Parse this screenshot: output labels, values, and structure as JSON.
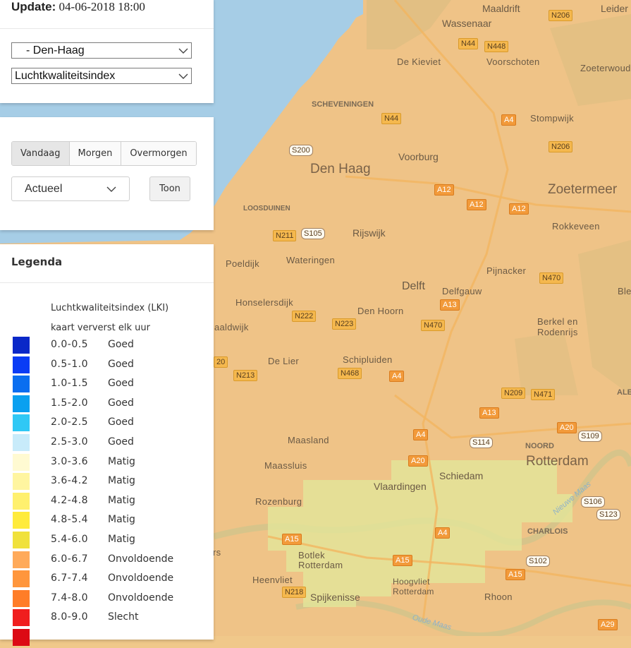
{
  "header": {
    "update_label": "Update:",
    "update_value": "04-06-2018 18:00"
  },
  "selects": {
    "location": "- Den-Haag",
    "index": "Luchtkwaliteitsindex"
  },
  "day_tabs": [
    "Vandaag",
    "Morgen",
    "Overmorgen"
  ],
  "active_tab": "Vandaag",
  "time_dropdown": "Actueel",
  "show_button": "Toon",
  "legend": {
    "title": "Legenda",
    "subtitle_1": "Luchtkwaliteitsindex (LKI)",
    "subtitle_2": "kaart ververst elk uur",
    "rows": [
      {
        "range": "0.0-0.5",
        "label": "Goed",
        "color": "#0a28c8"
      },
      {
        "range": "0.5-1.0",
        "label": "Goed",
        "color": "#0a3cf5"
      },
      {
        "range": "1.0-1.5",
        "label": "Goed",
        "color": "#0a6ef0"
      },
      {
        "range": "1.5-2.0",
        "label": "Goed",
        "color": "#0aa0f0"
      },
      {
        "range": "2.0-2.5",
        "label": "Goed",
        "color": "#30c8f5"
      },
      {
        "range": "2.5-3.0",
        "label": "Goed",
        "color": "#c8ebfa"
      },
      {
        "range": "3.0-3.6",
        "label": "Matig",
        "color": "#fffad2"
      },
      {
        "range": "3.6-4.2",
        "label": "Matig",
        "color": "#fff5a0"
      },
      {
        "range": "4.2-4.8",
        "label": "Matig",
        "color": "#fff06e"
      },
      {
        "range": "4.8-5.4",
        "label": "Matig",
        "color": "#ffeb3c"
      },
      {
        "range": "5.4-6.0",
        "label": "Matig",
        "color": "#f0e13c"
      },
      {
        "range": "6.0-6.7",
        "label": "Onvoldoende",
        "color": "#ffaa5a"
      },
      {
        "range": "6.7-7.4",
        "label": "Onvoldoende",
        "color": "#ff963c"
      },
      {
        "range": "7.4-8.0",
        "label": "Onvoldoende",
        "color": "#ff7d28"
      },
      {
        "range": "8.0-9.0",
        "label": "Slecht",
        "color": "#f01e1e"
      },
      {
        "range": "",
        "label": "",
        "color": "#dc0a14"
      }
    ]
  },
  "map": {
    "places": {
      "maaldrift": "Maaldrift",
      "wassenaar": "Wassenaar",
      "leiden": "Leider",
      "de_kieviet": "De Kieviet",
      "voorschoten": "Voorschoten",
      "zoeterwoude": "Zoeterwoude",
      "scheveningen": "SCHEVENINGEN",
      "stompwijk": "Stompwijk",
      "den_haag": "Den Haag",
      "voorburg": "Voorburg",
      "zoetermeer": "Zoetermeer",
      "loosduinen": "LOOSDUINEN",
      "rijswijk": "Rijswijk",
      "rokkeveen": "Rokkeveen",
      "poeldijk": "Poeldijk",
      "wateringen": "Wateringen",
      "pijnacker": "Pijnacker",
      "ble": "Ble",
      "delft": "Delft",
      "delfgauw": "Delfgauw",
      "honselersdijk": "Honselersdijk",
      "den_hoorn": "Den Hoorn",
      "naaldwijk": "aaldwijk",
      "berkel": "Berkel en Rodenrijs",
      "de_lier": "De Lier",
      "schipluiden": "Schipluiden",
      "ale": "ALE",
      "maasland": "Maasland",
      "noord": "NOORD",
      "maassluis": "Maassluis",
      "rotterdam": "Rotterdam",
      "schiedam": "Schiedam",
      "vlaardingen": "Vlaardingen",
      "rozenburg": "Rozenburg",
      "nieuwe_maas": "Nieuwe Maas",
      "charlois": "CHARLOIS",
      "botlek": "Botlek Rotterdam",
      "heenvliet": "Heenvliet",
      "hoogvliet": "Hoogvliet Rotterdam",
      "rhoon": "Rhoon",
      "spijkenisse": "Spijkenisse",
      "oude_maas": "Oude Maas",
      "rs": "rs"
    },
    "roads": {
      "n206a": "N206",
      "n44a": "N44",
      "n448": "N448",
      "n44b": "N44",
      "a4a": "A4",
      "s200": "S200",
      "n206b": "N206",
      "a12a": "A12",
      "a12b": "A12",
      "a12c": "A12",
      "n211": "N211",
      "s105": "S105",
      "n470a": "N470",
      "a13a": "A13",
      "n222": "N222",
      "n223": "N223",
      "n470b": "N470",
      "n468": "N468",
      "a4b": "A4",
      "n20": "20",
      "n213": "N213",
      "n209": "N209",
      "n471": "N471",
      "a13b": "A13",
      "a4c": "A4",
      "a20a": "A20",
      "s109": "S109",
      "s114": "S114",
      "a20b": "A20",
      "s106": "S106",
      "s123": "S123",
      "a15a": "A15",
      "a4d": "A4",
      "a15b": "A15",
      "s102": "S102",
      "a15c": "A15",
      "n218": "N218",
      "a29": "A29"
    }
  }
}
